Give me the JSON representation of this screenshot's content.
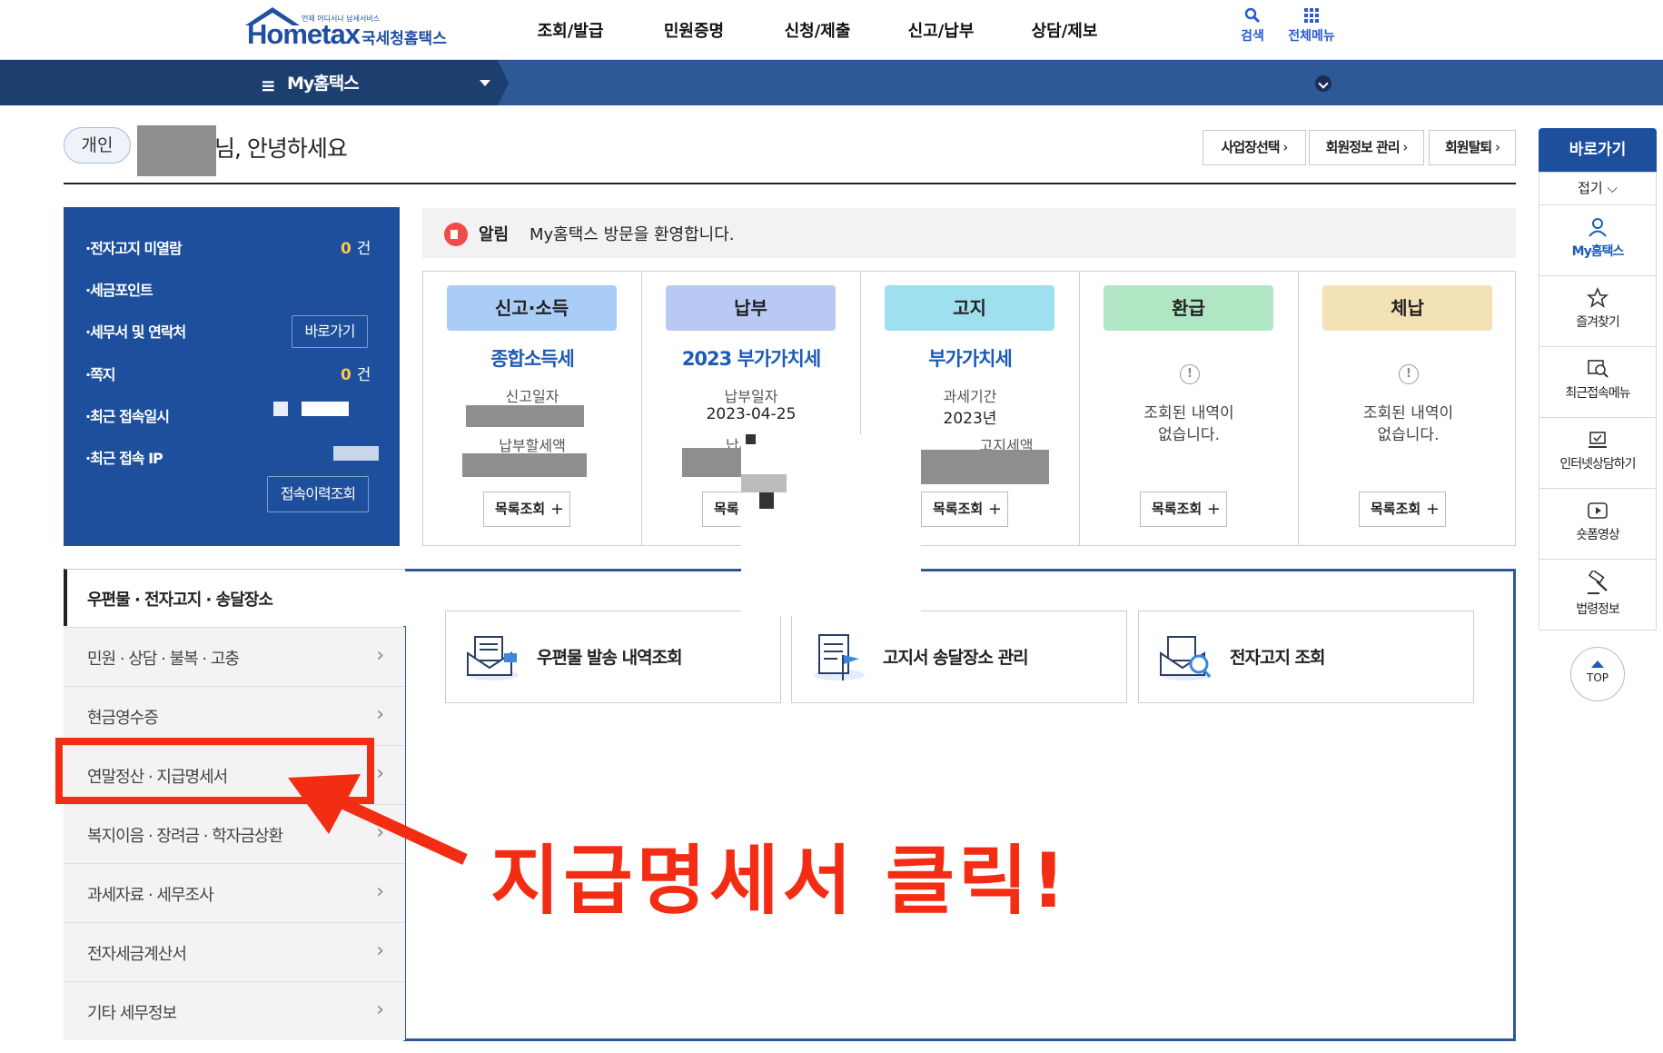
{
  "header": {
    "logo_small": "언제 어디서나 납세서비스",
    "logo_main": "Hometax",
    "logo_ko": "국세청홈택스",
    "gnb": [
      "조회/발급",
      "민원증명",
      "신청/제출",
      "신고/납부",
      "상담/제보"
    ],
    "search_label": "검색",
    "allmenu_label": "전체메뉴"
  },
  "nav": {
    "title": "My홈택스"
  },
  "greeting": {
    "badge": "개인",
    "suffix": "님, 안녕하세요",
    "buttons": [
      "사업장선택",
      "회원정보 관리",
      "회원탈퇴"
    ]
  },
  "info_panel": {
    "rows": [
      {
        "label": "전자고지 미열람",
        "value": "0",
        "unit": "건"
      },
      {
        "label": "세금포인트"
      },
      {
        "label": "세무서 및 연락처",
        "button": "바로가기"
      },
      {
        "label": "쪽지",
        "value": "0",
        "unit": "건"
      },
      {
        "label": "최근 접속일시"
      },
      {
        "label": "최근 접속 IP"
      }
    ],
    "history_button": "접속이력조회"
  },
  "alert": {
    "label": "알림",
    "message": "My홈택스 방문을 환영합니다."
  },
  "cards": [
    {
      "head": "신고·소득",
      "color": "#a9cdf6",
      "sub": "종합소득세",
      "k1": "신고일자",
      "v1": "",
      "k2": "납부할세액",
      "list": "목록조회"
    },
    {
      "head": "납부",
      "color": "#b9c9f4",
      "sub": "2023 부가가치세",
      "k1": "납부일자",
      "v1": "2023-04-25",
      "k2": "납부",
      "list": "목록"
    },
    {
      "head": "고지",
      "color": "#9ee0ee",
      "sub": "부가가치세",
      "k1": "과세기간",
      "v1": "2023년",
      "k2": "고지세액",
      "list": "목록조회"
    },
    {
      "head": "환급",
      "color": "#b1e6c4",
      "empty": "조회된 내역이\n없습니다.",
      "list": "목록조회"
    },
    {
      "head": "체납",
      "color": "#f2e2b6",
      "empty": "조회된 내역이\n없습니다.",
      "list": "목록조회"
    }
  ],
  "left_menu": {
    "active": "우편물 · 전자고지 · 송달장소",
    "items": [
      "민원 · 상담 · 불복 · 고충",
      "현금영수증",
      "연말정산 · 지급명세서",
      "복지이음 · 장려금 · 학자금상환",
      "과세자료 · 세무조사",
      "전자세금계산서",
      "기타 세무정보"
    ]
  },
  "quick_boxes": [
    "우편물 발송 내역조회",
    "고지서 송달장소 관리",
    "전자고지 조회"
  ],
  "right_quick": {
    "head": "바로가기",
    "fold": "접기 ⌵",
    "items": [
      "My홈택스",
      "즐겨찾기",
      "최근접속메뉴",
      "인터넷상담하기",
      "숏폼영상",
      "법령정보"
    ],
    "top": "TOP"
  },
  "annotation": {
    "text": "지급명세서 클릭!",
    "color": "#f22d14"
  }
}
